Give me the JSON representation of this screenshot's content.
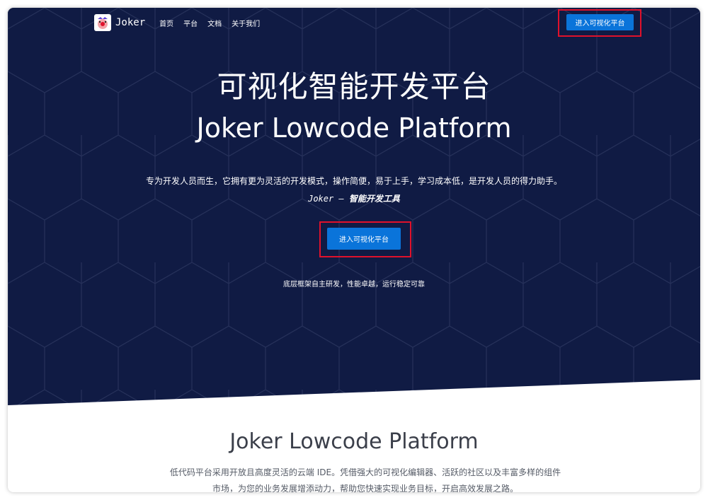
{
  "nav": {
    "logo_text": "Joker",
    "links": [
      "首页",
      "平台",
      "文档",
      "关于我们"
    ],
    "cta_label": "进入可视化平台"
  },
  "hero": {
    "title_cn": "可视化智能开发平台",
    "title_en": "Joker Lowcode Platform",
    "description": "专为开发人员而生，它拥有更为灵活的开发模式，操作简便，易于上手，学习成本低，是开发人员的得力助手。",
    "tagline_prefix": "Joker — ",
    "tagline_suffix": "智能开发工具",
    "cta_label": "进入可视化平台",
    "note": "底层框架自主研发，性能卓越，运行稳定可靠"
  },
  "section": {
    "title": "Joker Lowcode Platform",
    "description": "低代码平台采用开放且高度灵活的云端 IDE。凭借强大的可视化编辑器、活跃的社区以及丰富多样的组件市场，为您的业务发展增添动力，帮助您快速实现业务目标，开启高效发展之路。"
  },
  "colors": {
    "hero_bg": "#101b44",
    "button": "#0a74da",
    "highlight": "#e0112b"
  }
}
